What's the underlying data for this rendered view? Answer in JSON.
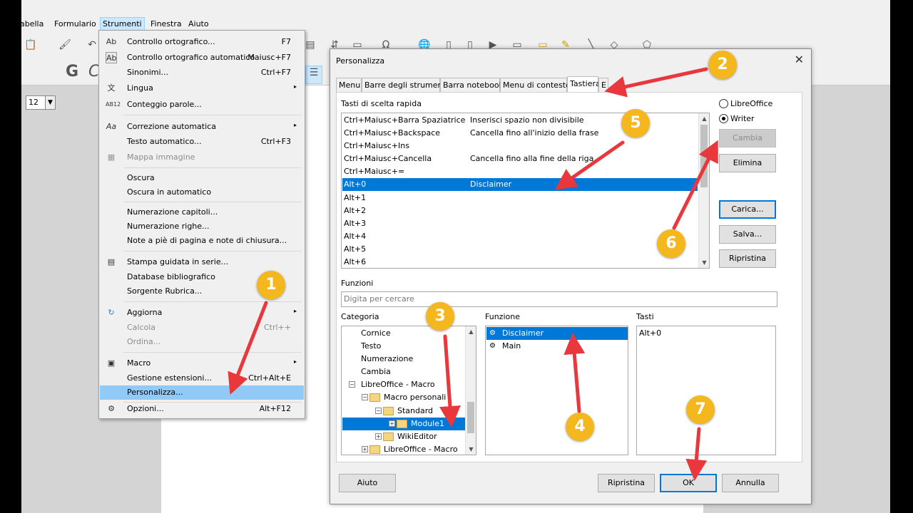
{
  "menubar": {
    "items": [
      "Tabella",
      "Formulario",
      "Strumenti",
      "Finestra",
      "Aiuto"
    ],
    "partial_first": "abella"
  },
  "toolbar": {
    "font_size": "12",
    "format_glyphs": [
      "G",
      "C"
    ]
  },
  "strumenti_menu": {
    "items": [
      {
        "label": "Controllo ortografico...",
        "shortcut": "F7",
        "icon": "spellcheck-icon"
      },
      {
        "label": "Controllo ortografico automatico",
        "shortcut": "Maiusc+F7",
        "icon": "auto-spellcheck-icon"
      },
      {
        "label": "Sinonimi...",
        "shortcut": "Ctrl+F7"
      },
      {
        "label": "Lingua",
        "submenu": true,
        "icon": "language-icon"
      },
      {
        "label": "Conteggio parole...",
        "icon": "word-count-icon"
      },
      {
        "label": "Correzione automatica",
        "submenu": true,
        "icon": "autocorrect-icon"
      },
      {
        "label": "Testo automatico...",
        "shortcut": "Ctrl+F3"
      },
      {
        "label": "Mappa immagine",
        "disabled": true,
        "icon": "image-map-icon"
      },
      {
        "label": "Oscura"
      },
      {
        "label": "Oscura in automatico"
      },
      {
        "label": "Numerazione capitoli..."
      },
      {
        "label": "Numerazione righe..."
      },
      {
        "label": "Note a piè di pagina e note di chiusura..."
      },
      {
        "label": "Stampa guidata in serie...",
        "icon": "mail-merge-icon"
      },
      {
        "label": "Database bibliografico"
      },
      {
        "label": "Sorgente Rubrica..."
      },
      {
        "label": "Aggiorna",
        "submenu": true,
        "icon": "refresh-icon"
      },
      {
        "label": "Calcola",
        "shortcut": "Ctrl++",
        "disabled": true
      },
      {
        "label": "Ordina...",
        "disabled": true
      },
      {
        "label": "Macro",
        "submenu": true,
        "icon": "macro-icon"
      },
      {
        "label": "Gestione estensioni...",
        "shortcut": "Ctrl+Alt+E"
      },
      {
        "label": "Personalizza...",
        "highlighted": true
      },
      {
        "label": "Opzioni...",
        "shortcut": "Alt+F12",
        "icon": "gear-icon"
      }
    ]
  },
  "dialog": {
    "title": "Personalizza",
    "close": "✕",
    "tabs": [
      "Menu",
      "Barre degli strumenti",
      "Barra notebook",
      "Menu di contesto",
      "Tastiera",
      "E"
    ],
    "selected_tab": "Tastiera",
    "shortcuts_label": "Tasti di scelta rapida",
    "shortcuts": [
      {
        "key": "Ctrl+Maiusc+Barra Spaziatrice",
        "action": "Inserisci spazio non divisibile"
      },
      {
        "key": "Ctrl+Maiusc+Backspace",
        "action": "Cancella fino all'inizio della frase"
      },
      {
        "key": "Ctrl+Maiusc+Ins",
        "action": ""
      },
      {
        "key": "Ctrl+Maiusc+Cancella",
        "action": "Cancella fino alla fine della riga"
      },
      {
        "key": "Ctrl+Maiusc+=",
        "action": ""
      },
      {
        "key": "Alt+0",
        "action": "Disclaimer",
        "selected": true
      },
      {
        "key": "Alt+1",
        "action": ""
      },
      {
        "key": "Alt+2",
        "action": ""
      },
      {
        "key": "Alt+3",
        "action": ""
      },
      {
        "key": "Alt+4",
        "action": ""
      },
      {
        "key": "Alt+5",
        "action": ""
      },
      {
        "key": "Alt+6",
        "action": ""
      }
    ],
    "radio_libreoffice": "LibreOffice",
    "radio_writer": "Writer",
    "btn_cambia": "Cambia",
    "btn_elimina": "Elimina",
    "btn_carica": "Carica...",
    "btn_salva": "Salva...",
    "btn_ripristina_side": "Ripristina",
    "functions_label": "Funzioni",
    "search_placeholder": "Digita per cercare",
    "categoria_label": "Categoria",
    "funzione_label": "Funzione",
    "tasti_label": "Tasti",
    "categories": [
      {
        "label": "Cornice",
        "indent": 0
      },
      {
        "label": "Testo",
        "indent": 0
      },
      {
        "label": "Numerazione",
        "indent": 0
      },
      {
        "label": "Cambia",
        "indent": 0
      },
      {
        "label": "LibreOffice - Macro",
        "indent": 1,
        "exp": "⊟"
      },
      {
        "label": "Macro personali",
        "indent": 2,
        "exp": "⊟",
        "folder": true
      },
      {
        "label": "Standard",
        "indent": 3,
        "exp": "⊟",
        "folder": true
      },
      {
        "label": "Module1",
        "indent": 4,
        "exp": "⊞",
        "folder": true,
        "selected": true
      },
      {
        "label": "WikiEditor",
        "indent": 3,
        "exp": "⊞",
        "folder": true
      },
      {
        "label": "LibreOffice - Macro",
        "indent": 2,
        "exp": "⊞",
        "folder": true
      }
    ],
    "functions": [
      {
        "label": "Disclaimer",
        "selected": true
      },
      {
        "label": "Main"
      }
    ],
    "keys": [
      "Alt+0"
    ],
    "btn_aiuto": "Aiuto",
    "btn_ripristina": "Ripristina",
    "btn_ok": "OK",
    "btn_annulla": "Annulla"
  },
  "annotations": [
    "1",
    "2",
    "3",
    "4",
    "5",
    "6",
    "7"
  ],
  "colors": {
    "badge": "#f5b71e",
    "arrow": "#e8383d",
    "selection": "#0078d7",
    "menu_highlight": "#91c9f7"
  }
}
